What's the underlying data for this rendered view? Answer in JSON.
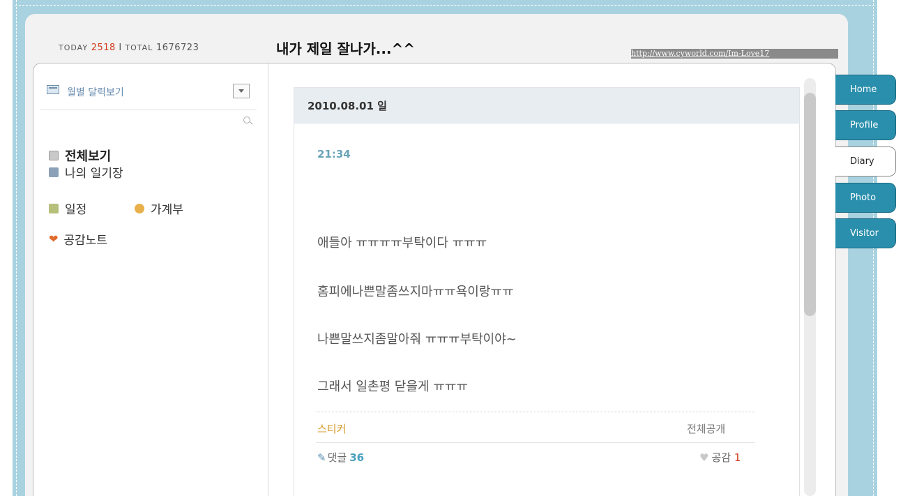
{
  "header": {
    "today_label": "TODAY",
    "today_count": "2518",
    "separator": "I",
    "total_label": "TOTAL",
    "total_count": "1676723",
    "title": "내가 제일 잘나가...^^",
    "url": "http://www.cyworld.com/Im-Love17"
  },
  "sidebar": {
    "calendar_toggle_label": "월별 달력보기",
    "items": [
      {
        "label": "전체보기",
        "icon": "book-icon"
      },
      {
        "label": "나의 일기장",
        "icon": "diary-icon"
      },
      {
        "label": "일정",
        "icon": "schedule-icon"
      },
      {
        "label": "가계부",
        "icon": "coin-icon"
      },
      {
        "label": "공감노트",
        "icon": "heart-icon"
      }
    ]
  },
  "post": {
    "date": "2010.08.01 일",
    "time": "21:34",
    "lines": [
      "애들아 ㅠㅠㅠㅠ부탁이다 ㅠㅠㅠ",
      "홈피에나쁜말좀쓰지마ㅠㅠ욕이랑ㅠㅠ",
      "나쁜말쓰지좀말아줘 ㅠㅠㅠ부탁이야~",
      "그래서 일촌평 닫을게 ㅠㅠㅠ"
    ],
    "sticker_label": "스티커",
    "visibility": "전체공개",
    "comments_label": "댓글",
    "comments_count": "36",
    "empathy_label": "공감",
    "empathy_count": "1"
  },
  "tabs": [
    {
      "label": "Home"
    },
    {
      "label": "Profile"
    },
    {
      "label": "Diary",
      "active": true
    },
    {
      "label": "Photo"
    },
    {
      "label": "Visitor"
    }
  ],
  "colors": {
    "frame": "#a9d2e0",
    "tab": "#2a8fac",
    "count_red": "#d23a1c",
    "time_blue": "#6aa3b8"
  }
}
